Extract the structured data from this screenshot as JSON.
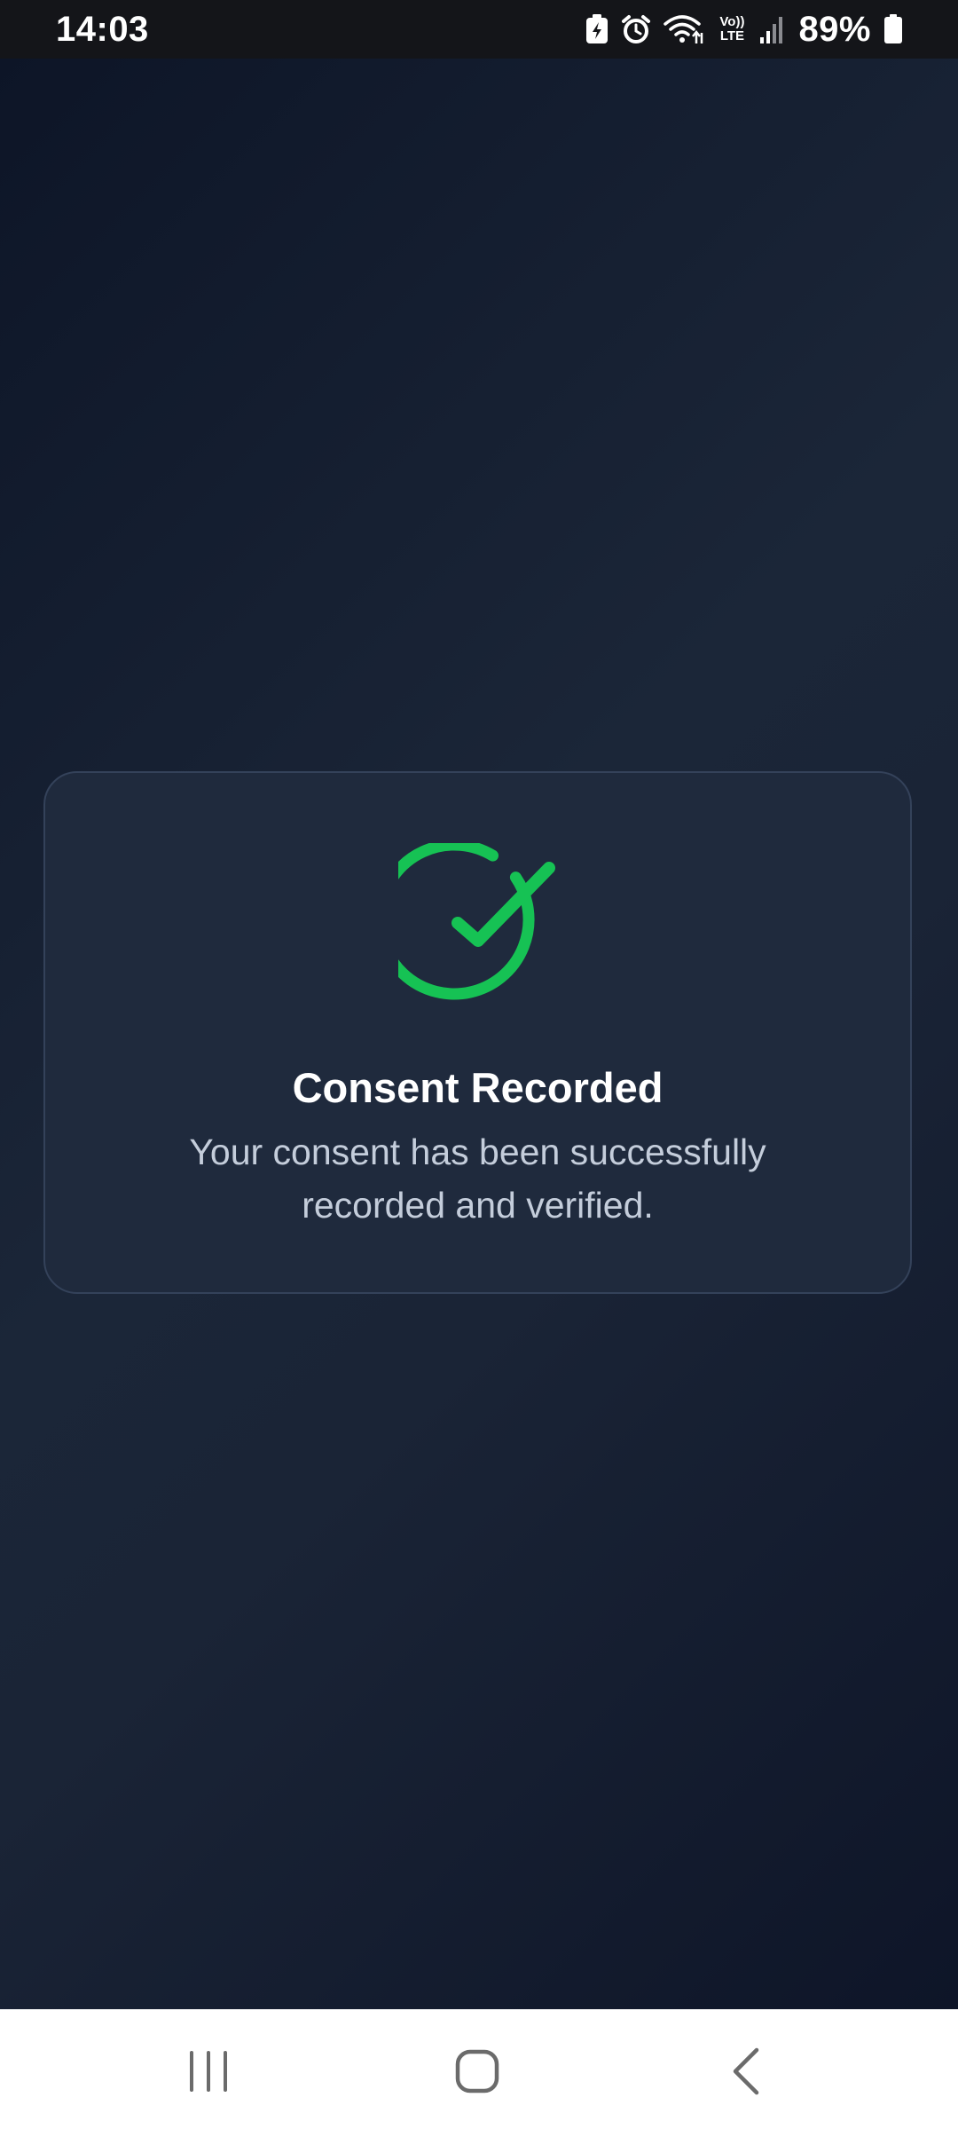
{
  "status_bar": {
    "time": "14:03",
    "battery_percent": "89%",
    "icons": [
      "battery-saver-icon",
      "alarm-icon",
      "wifi-icon",
      "volte-icon",
      "signal-icon",
      "battery-icon"
    ],
    "volte_top": "Vo))",
    "volte_bottom": "LTE"
  },
  "card": {
    "icon": "check-circle-icon",
    "title": "Consent Recorded",
    "description": "Your consent has been successfully recorded and verified."
  },
  "nav_bar": {
    "icons": [
      "recent-apps-icon",
      "home-icon",
      "back-icon"
    ]
  },
  "colors": {
    "success": "#16c254",
    "card_bg": "#1f2a3d",
    "card_border": "#34425a",
    "title": "#ffffff",
    "description": "#c4cddb"
  }
}
